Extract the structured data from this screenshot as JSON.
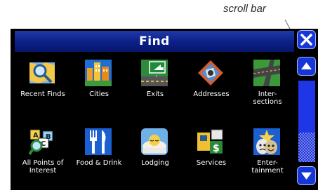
{
  "annotation": {
    "callout_label": "scroll bar"
  },
  "window": {
    "title": "Find"
  },
  "controls": {
    "close_icon": "close-icon",
    "up_icon": "arrow-up-icon",
    "down_icon": "arrow-down-icon"
  },
  "scrollbar": {
    "position": 0.0,
    "visible_fraction": 0.64
  },
  "tiles": [
    {
      "label": "Recent Finds",
      "icon": "recent-finds-icon"
    },
    {
      "label": "Cities",
      "icon": "cities-icon"
    },
    {
      "label": "Exits",
      "icon": "exits-icon"
    },
    {
      "label": "Addresses",
      "icon": "addresses-icon"
    },
    {
      "label": "Inter-\nsections",
      "icon": "intersections-icon"
    },
    {
      "label": "All Points of\nInterest",
      "icon": "points-of-interest-icon"
    },
    {
      "label": "Food & Drink",
      "icon": "food-drink-icon"
    },
    {
      "label": "Lodging",
      "icon": "lodging-icon"
    },
    {
      "label": "Services",
      "icon": "services-icon"
    },
    {
      "label": "Enter-\ntainment",
      "icon": "entertainment-icon"
    }
  ],
  "colors": {
    "titlebar": "#0b1f86",
    "background": "#000000",
    "button": "#1636d6",
    "text": "#ffffff"
  }
}
